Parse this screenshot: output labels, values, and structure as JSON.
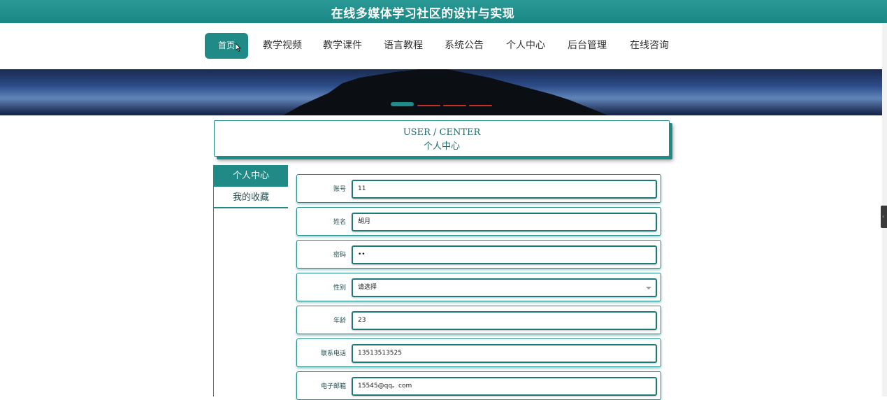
{
  "header": {
    "title": "在线多媒体学习社区的设计与实现"
  },
  "nav": {
    "items": [
      {
        "label": "首页",
        "active": true
      },
      {
        "label": "教学视频"
      },
      {
        "label": "教学课件"
      },
      {
        "label": "语言教程"
      },
      {
        "label": "系统公告"
      },
      {
        "label": "个人中心"
      },
      {
        "label": "后台管理"
      },
      {
        "label": "在线咨询"
      }
    ]
  },
  "section": {
    "en": "USER / CENTER",
    "zh": "个人中心"
  },
  "left_menu": {
    "items": [
      {
        "label": "个人中心",
        "active": true
      },
      {
        "label": "我的收藏"
      }
    ]
  },
  "form": {
    "fields": [
      {
        "label": "账号",
        "value": "11"
      },
      {
        "label": "姓名",
        "value": "胡月"
      },
      {
        "label": "密码",
        "value": "••"
      },
      {
        "label": "性别",
        "value": "请选择",
        "type": "select"
      },
      {
        "label": "年龄",
        "value": "23"
      },
      {
        "label": "联系电话",
        "value": "13513513525"
      },
      {
        "label": "电子邮箱",
        "value": "15545@qq。com"
      }
    ]
  },
  "colors": {
    "accent": "#1f8a86",
    "carousel_inactive": "#c0322a"
  }
}
